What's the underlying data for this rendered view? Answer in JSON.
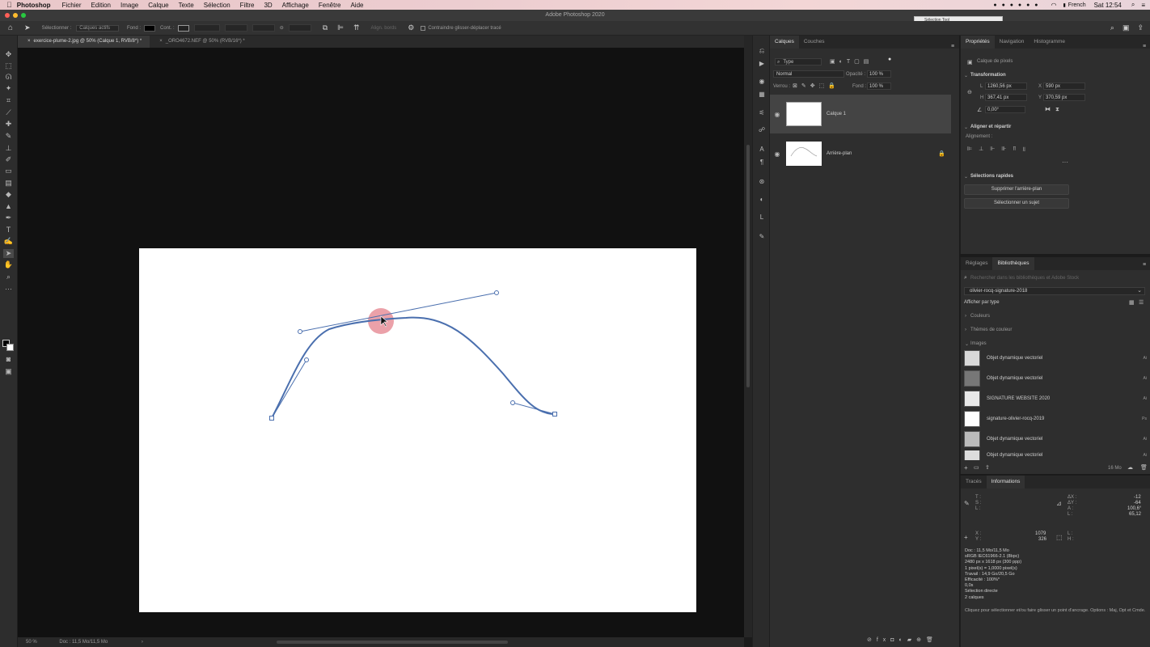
{
  "menubar": {
    "app": "Photoshop",
    "items": [
      "Fichier",
      "Edition",
      "Image",
      "Calque",
      "Texte",
      "Sélection",
      "Filtre",
      "3D",
      "Affichage",
      "Fenêtre",
      "Aide"
    ],
    "language": "French",
    "clock": "Sat 12:54"
  },
  "window": {
    "title": "Adobe Photoshop 2020",
    "floating_panel": "Sélection Tool"
  },
  "options": {
    "select_label": "Sélectionner :",
    "select_value": "Calques actifs",
    "fill_label": "Fond :",
    "stroke_label": "Cont. :",
    "align_edges": "Align. bords",
    "constrain": "Contraindre glisser-déplacer tracé"
  },
  "doc_tabs": [
    {
      "label": "exercice-plume-2.jpg @ 50% (Calque 1, RVB/8*) *"
    },
    {
      "label": "_ORO4672.NEF @ 50% (RVB/16*) *"
    }
  ],
  "status": {
    "zoom": "50 %",
    "doc": "Doc : 11,5 Mo/11,5 Mo"
  },
  "layers_panel": {
    "tabs": [
      "Calques",
      "Couches"
    ],
    "filter": "Type",
    "blend_mode": "Normal",
    "opacity_label": "Opacité :",
    "opacity": "100 %",
    "lock_label": "Verrou :",
    "fill_label": "Fond :",
    "fill": "100 %",
    "layers": [
      {
        "name": "Calque 1",
        "selected": true
      },
      {
        "name": "Arrière-plan",
        "locked": true
      }
    ]
  },
  "properties": {
    "tabs": [
      "Propriétés",
      "Navigation",
      "Histogramme"
    ],
    "kind": "Calque de pixels",
    "transform_title": "Transformation",
    "L_label": "L",
    "L": "1260,56 px",
    "X_label": "X",
    "X": "590 px",
    "H_label": "H",
    "H": "367,41 px",
    "Y_label": "Y",
    "Y": "370,59 px",
    "angle": "0,00°",
    "align_title": "Aligner et répartir",
    "align_label": "Alignement :",
    "quick_title": "Sélections rapides",
    "btn_remove_bg": "Supprimer l'arrière-plan",
    "btn_select_subject": "Sélectionner un sujet"
  },
  "libraries": {
    "tabs": [
      "Réglages",
      "Bibliothèques"
    ],
    "search_placeholder": "Rechercher dans les bibliothèques et Adobe Stock",
    "library": "olivier-rocq-signature-2018",
    "view_by": "Afficher par type",
    "groups": [
      "Couleurs",
      "Thèmes de couleur",
      "Images"
    ],
    "items": [
      {
        "name": "Objet dynamique vectoriel",
        "badge": "Ai"
      },
      {
        "name": "Objet dynamique vectoriel",
        "badge": "Ai"
      },
      {
        "name": "SIGNATURE WEBSITE 2020",
        "badge": "Ai"
      },
      {
        "name": "signature-olivier-rocq-2019",
        "badge": "Ps"
      },
      {
        "name": "Objet dynamique vectoriel",
        "badge": "Ai"
      },
      {
        "name": "Objet dynamique vectoriel",
        "badge": "Ai"
      }
    ],
    "storage": "16 Mo"
  },
  "info_panel": {
    "tabs": [
      "Tracés",
      "Informations"
    ],
    "T": "T :",
    "S": "S :",
    "L": "L :",
    "dx_label": "ΔX :",
    "dx": "-12",
    "dy_label": "ΔY :",
    "dy": "-64",
    "A_label": "A :",
    "A": "100,6°",
    "D_label": "L :",
    "D": "65,12",
    "X_label": "X :",
    "X": "1079",
    "Y_label": "Y :",
    "Y": "326",
    "Lw": "L :",
    "Hh": "H :",
    "details": [
      "Doc : 11,5 Mo/11,5 Mo",
      "sRGB IEC61966-2.1 (8bpc)",
      "2480 px x 1618 px (300 ppp)",
      "1 pixel(s) = 1,0000 pixel(s)",
      "Travail : 14,9 Go/20,5 Go",
      "Efficacité : 100%*",
      "0,0s",
      "Sélection directe",
      "2 calques"
    ],
    "hint": "Cliquez pour sélectionner et/ou faire glisser un point d'ancrage. Options : Maj, Opt et Cmde."
  },
  "colors": {
    "path": "#4a6fae",
    "cursor_halo": "#e8909a",
    "panel": "#2e2e2e"
  }
}
